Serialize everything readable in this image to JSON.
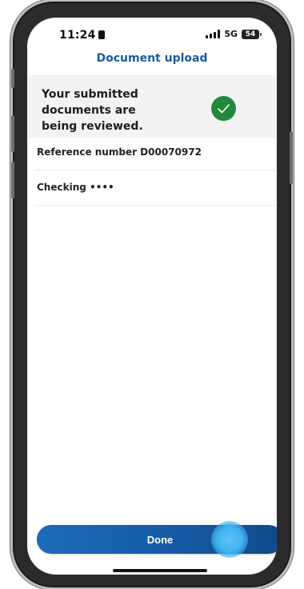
{
  "status_bar": {
    "time": "11:24",
    "network": "5G",
    "battery": "54"
  },
  "header": {
    "title": "Document upload"
  },
  "status_card": {
    "message": "Your submitted documents are being reviewed.",
    "icon": "checkmark-circle-icon",
    "icon_color": "#1f8a3b"
  },
  "details": {
    "reference": "Reference number D00070972",
    "account": "Checking ••••"
  },
  "actions": {
    "done_label": "Done",
    "button_color": "#1559a3"
  }
}
